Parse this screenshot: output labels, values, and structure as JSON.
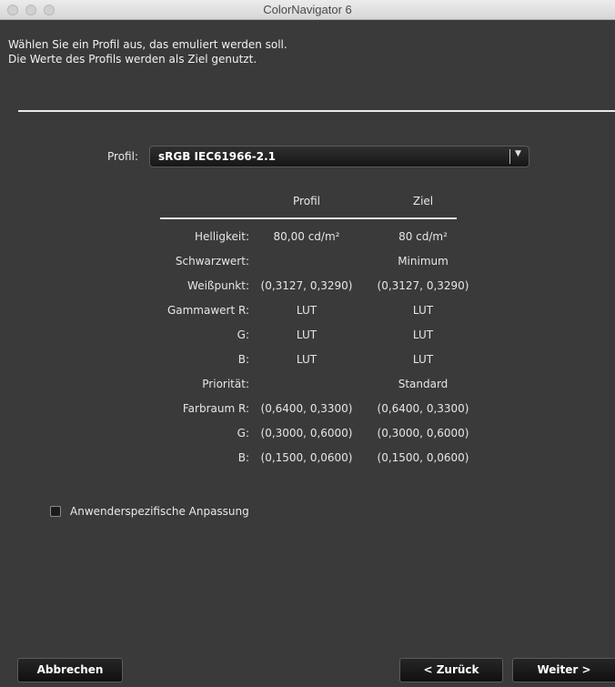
{
  "window": {
    "title": "ColorNavigator 6"
  },
  "instructions": {
    "line1": "Wählen Sie ein Profil aus, das emuliert werden soll.",
    "line2": "Die Werte des Profils werden als Ziel genutzt."
  },
  "profile": {
    "label": "Profil:",
    "selected": "sRGB IEC61966-2.1"
  },
  "table": {
    "headers": {
      "profil": "Profil",
      "ziel": "Ziel"
    },
    "rows": [
      {
        "label": "Helligkeit:",
        "profil": "80,00 cd/m²",
        "ziel": "80 cd/m²"
      },
      {
        "label": "Schwarzwert:",
        "profil": "",
        "ziel": "Minimum"
      },
      {
        "label": "Weißpunkt:",
        "profil": "(0,3127, 0,3290)",
        "ziel": "(0,3127, 0,3290)"
      },
      {
        "label": "Gammawert R:",
        "profil": "LUT",
        "ziel": "LUT"
      },
      {
        "label": "G:",
        "profil": "LUT",
        "ziel": "LUT"
      },
      {
        "label": "B:",
        "profil": "LUT",
        "ziel": "LUT"
      },
      {
        "label": "Priorität:",
        "profil": "",
        "ziel": "Standard"
      },
      {
        "label": "Farbraum R:",
        "profil": "(0,6400, 0,3300)",
        "ziel": "(0,6400, 0,3300)"
      },
      {
        "label": "G:",
        "profil": "(0,3000, 0,6000)",
        "ziel": "(0,3000, 0,6000)"
      },
      {
        "label": "B:",
        "profil": "(0,1500, 0,0600)",
        "ziel": "(0,1500, 0,0600)"
      }
    ]
  },
  "custom_adjustment": {
    "label": "Anwenderspezifische Anpassung",
    "checked": false
  },
  "buttons": {
    "cancel": "Abbrechen",
    "back": "< Zurück",
    "next": "Weiter >"
  }
}
